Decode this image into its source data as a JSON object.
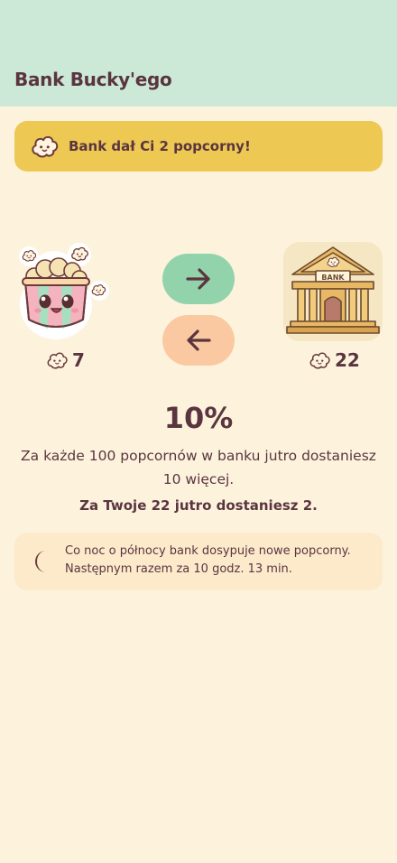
{
  "header": {
    "title": "Bank Bucky'ego"
  },
  "banner": {
    "icon": "popcorn-icon",
    "text": "Bank dał Ci 2 popcorny!"
  },
  "user": {
    "balance": "7",
    "icon": "popcorn-icon"
  },
  "bank": {
    "balance": "22",
    "icon": "popcorn-icon"
  },
  "actions": {
    "deposit_icon": "arrow-right-icon",
    "withdraw_icon": "arrow-left-icon"
  },
  "interest": {
    "rate": "10%",
    "description": "Za każde 100 popcornów w banku jutro dostaniesz 10 więcej.",
    "tomorrow": "Za Twoje 22 jutro dostaniesz 2."
  },
  "info": {
    "icon": "moon-icon",
    "line1": "Co noc o północy bank dosypuje nowe popcorny.",
    "line2": "Następnym razem za 10 godz. 13 min."
  },
  "colors": {
    "background": "#FDF3DD",
    "header": "#CCE9D8",
    "banner": "#EDC853",
    "deposit": "#93D3AC",
    "withdraw": "#FBC9A1",
    "text": "#5A3540"
  }
}
